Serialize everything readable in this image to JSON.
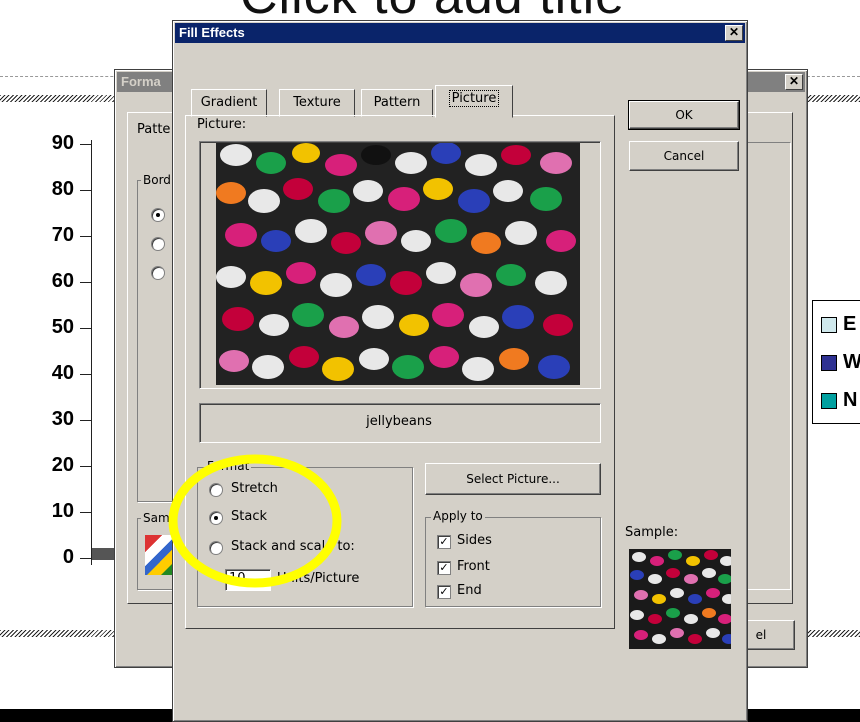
{
  "slide": {
    "title": "Click to add title",
    "y_ticks": [
      "90",
      "80",
      "70",
      "60",
      "50",
      "40",
      "30",
      "20",
      "10",
      "0"
    ],
    "legend": [
      {
        "text": "E",
        "color": "#cfe8ec"
      },
      {
        "text": "W",
        "color": "#2e3192"
      },
      {
        "text": "N",
        "color": "#00a0a0"
      }
    ]
  },
  "format_dialog": {
    "title": "Forma",
    "tab_label": "Patte",
    "border_group": "Bord",
    "sample_label": "Sam",
    "cancel_fragment": "el"
  },
  "fill_effects": {
    "title": "Fill Effects",
    "close_glyph": "✕",
    "tabs": [
      "Gradient",
      "Texture",
      "Pattern",
      "Picture"
    ],
    "active_tab": "Picture",
    "picture_label": "Picture:",
    "picture_name": "jellybeans",
    "ok_label": "OK",
    "cancel_label": "Cancel",
    "select_picture_label": "Select Picture...",
    "format_group": "Format",
    "format_options": [
      "Stretch",
      "Stack",
      "Stack and scale to:"
    ],
    "format_selected": "Stack",
    "scale_value": "10",
    "units_label": "Units/Picture",
    "apply_group": "Apply to",
    "apply_options": [
      {
        "label": "Sides",
        "checked": true
      },
      {
        "label": "Front",
        "checked": true
      },
      {
        "label": "End",
        "checked": true
      }
    ],
    "sample_label": "Sample:"
  },
  "highlight_color": "#ffff00"
}
